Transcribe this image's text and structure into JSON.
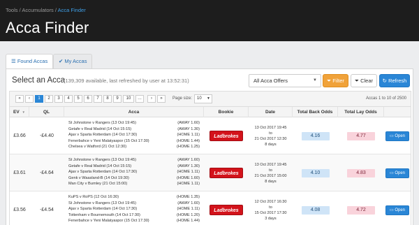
{
  "breadcrumb": [
    "Tools",
    "Accumulators",
    "Acca Finder"
  ],
  "breadcrumb_sep": "/",
  "page_title": "Acca Finder",
  "tabs": [
    {
      "label": "Found Accas",
      "icon": "list-icon",
      "active": true
    },
    {
      "label": "My Accas",
      "icon": "check-icon",
      "active": false
    }
  ],
  "section": {
    "title": "Select an Acca",
    "subtitle": "(139,309 available, last refreshed by user at 13:52:31)"
  },
  "controls": {
    "offer_select": "All Acca Offers",
    "filter_label": "Filter",
    "clear_label": "Clear",
    "refresh_label": "Refresh"
  },
  "pagination": {
    "buttons": [
      "«",
      "‹",
      "1",
      "2",
      "3",
      "4",
      "5",
      "6",
      "7",
      "8",
      "9",
      "10",
      "…",
      "›",
      "»"
    ],
    "active_page": "1",
    "page_size_label": "Page size:",
    "page_size": "10",
    "info": "Accas 1 to 10 of 2500"
  },
  "columns": [
    "EV",
    "QL",
    "Acca",
    "Bookie",
    "Date",
    "Total Back Odds",
    "Total Lay Odds",
    ""
  ],
  "rows": [
    {
      "ev": "£3.66",
      "ql": "-£4.40",
      "legs": [
        {
          "match": "St Johnstone v Rangers (13 Oct 19:45)",
          "sel": "(AWAY 1.60)"
        },
        {
          "match": "Getafe v Real Madrid (14 Oct 15:15)",
          "sel": "(AWAY 1.30)"
        },
        {
          "match": "Ajax v Sparta Rotterdam (14 Oct 17:30)",
          "sel": "(HOME 1.11)"
        },
        {
          "match": "Fenerbahce v Yeni Malatyaspor (15 Oct 17:30)",
          "sel": "(HOME 1.44)"
        },
        {
          "match": "Chelsea v Watford (21 Oct 12:30)",
          "sel": "(HOME 1.25)"
        }
      ],
      "bookie": "Ladbrokes",
      "date": [
        "13 Oct 2017 19:45",
        "to",
        "21 Oct 2017 12:30",
        "8 days"
      ],
      "back": "4.16",
      "lay": "4.77",
      "open": "Open"
    },
    {
      "ev": "£3.61",
      "ql": "-£4.64",
      "legs": [
        {
          "match": "St Johnstone v Rangers (13 Oct 19:45)",
          "sel": "(AWAY 1.60)"
        },
        {
          "match": "Getafe v Real Madrid (14 Oct 15:15)",
          "sel": "(AWAY 1.30)"
        },
        {
          "match": "Ajax v Sparta Rotterdam (14 Oct 17:30)",
          "sel": "(HOME 1.11)"
        },
        {
          "match": "Genk v Waasland-B (14 Oct 19:30)",
          "sel": "(HOME 1.60)"
        },
        {
          "match": "Man City v Burnley (21 Oct 15:00)",
          "sel": "(HOME 1.11)"
        }
      ],
      "bookie": "Ladbrokes",
      "date": [
        "13 Oct 2017 19:45",
        "to",
        "21 Oct 2017 15:00",
        "8 days"
      ],
      "back": "4.10",
      "lay": "4.83",
      "open": "Open"
    },
    {
      "ev": "£3.56",
      "ql": "-£4.54",
      "legs": [
        {
          "match": "KuPS v RoPS (12 Oct 16:30)",
          "sel": "(HOME 1.35)"
        },
        {
          "match": "St Johnstone v Rangers (13 Oct 19:45)",
          "sel": "(AWAY 1.60)"
        },
        {
          "match": "Ajax v Sparta Rotterdam (14 Oct 17:30)",
          "sel": "(HOME 1.11)"
        },
        {
          "match": "Tottenham v Bournemouth (14 Oct 17:30)",
          "sel": "(HOME 1.20)"
        },
        {
          "match": "Fenerbahce v Yeni Malatyaspor (15 Oct 17:30)",
          "sel": "(HOME 1.44)"
        }
      ],
      "bookie": "Ladbrokes",
      "date": [
        "12 Oct 2017 16:30",
        "to",
        "15 Oct 2017 17:30",
        "3 days"
      ],
      "back": "4.08",
      "lay": "4.72",
      "open": "Open"
    }
  ],
  "colors": {
    "header_bg": "#1d1d1d",
    "link_blue": "#3fa0e8",
    "primary_btn": "#2a86d6",
    "filter_btn": "#f0a23a",
    "back_odds_bg": "#cfe4f7",
    "lay_odds_bg": "#f9d3db",
    "bookie_red": "#d3131b"
  }
}
